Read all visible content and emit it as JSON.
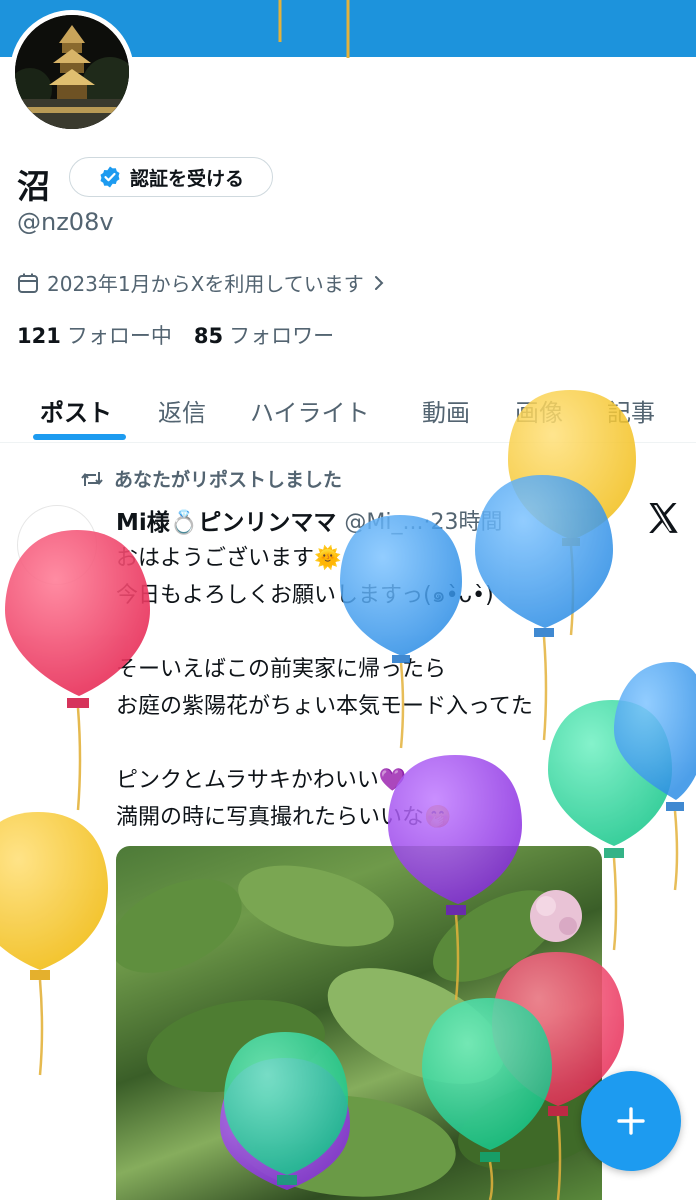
{
  "profile": {
    "name": "沼",
    "verify_button": "認証を受ける",
    "handle": "@nz08v",
    "joined": "2023年1月からXを利用しています",
    "following_count": "121",
    "following_label": "フォロー中",
    "followers_count": "85",
    "followers_label": "フォロワー"
  },
  "tabs": [
    "ポスト",
    "返信",
    "ハイライト",
    "動画",
    "画像",
    "記事"
  ],
  "active_tab": "ポスト",
  "post": {
    "repost_label": "あなたがリポストしました",
    "author_name": "Mi様💍ピンリンママ",
    "author_handle_time": "@Mi_...·23時間",
    "text": "おはようございます🌞\n今日もよろしくお願いしますっ(๑•̀ᴗ•̀)\n\nそーいえばこの前実家に帰ったら\nお庭の紫陽花がちょい本気モード入ってた\n\nピンクとムラサキかわいい💜\n満開の時に写真撮れたらいいな🤭"
  },
  "icons": {
    "calendar": "calendar-icon",
    "chevron": "chevron-right-icon",
    "verified": "verified-badge-icon",
    "repost": "repost-icon",
    "x_logo": "x-logo-icon",
    "compose": "plus-icon"
  },
  "colors": {
    "accent": "#1d9bf0",
    "banner": "#1d93dc",
    "secondary_text": "#536471"
  }
}
